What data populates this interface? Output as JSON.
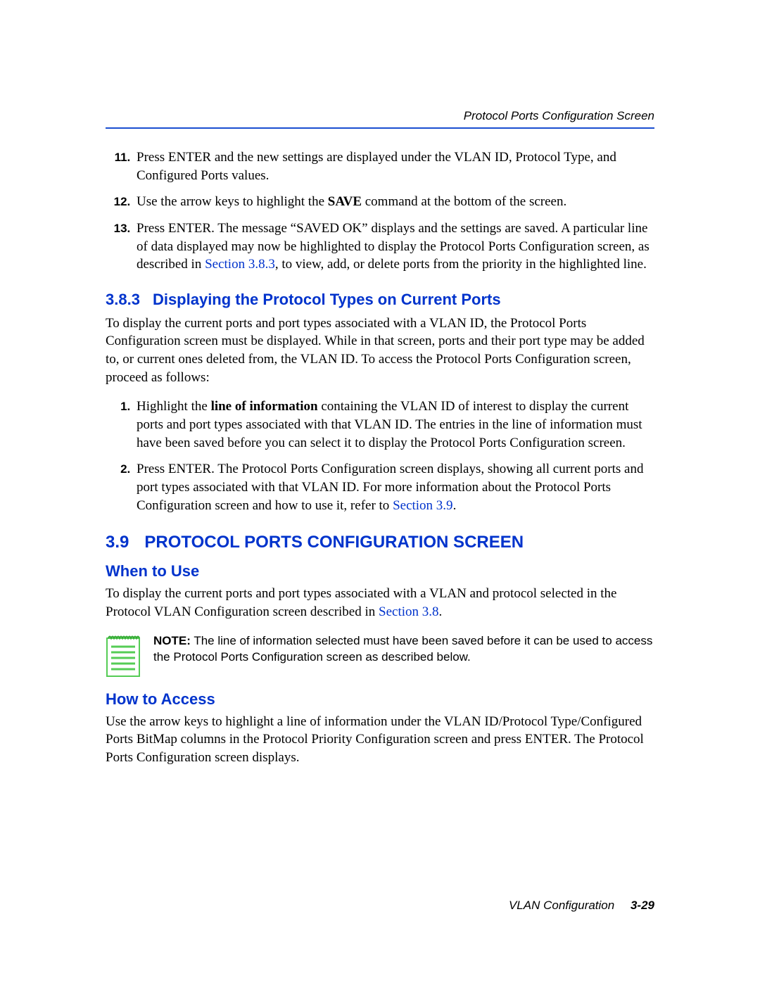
{
  "header": {
    "running_title": "Protocol Ports Configuration Screen"
  },
  "steps_a": {
    "start": 11,
    "items": [
      {
        "prefix": "Press ENTER and the new settings are displayed under the VLAN ID, Protocol Type, and Configured Ports values."
      },
      {
        "prefix": "Use the arrow keys to highlight the ",
        "bold": "SAVE",
        "suffix": " command at the bottom of the screen."
      },
      {
        "prefix": "Press ENTER. The message “SAVED OK” displays and the settings are saved. A particular line of data displayed may now be highlighted to display the Protocol Ports Configuration screen, as described in ",
        "link": "Section 3.8.3",
        "suffix": ", to view, add, or delete ports from the priority in the highlighted line."
      }
    ]
  },
  "section_383": {
    "number": "3.8.3",
    "title": "Displaying the Protocol Types on Current Ports",
    "intro": "To display the current ports and port types associated with a VLAN ID, the Protocol Ports Configuration screen must be displayed. While in that screen, ports and their port type may be added to, or current ones deleted from, the VLAN ID. To access the Protocol Ports Configuration screen, proceed as follows:"
  },
  "steps_b": {
    "start": 1,
    "items": [
      {
        "prefix": "Highlight the ",
        "bold": "line of information",
        "suffix": " containing the VLAN ID of interest to display the current ports and port types associated with that VLAN ID. The entries in the line of information must have been saved before you can select it to display the Protocol Ports Configuration screen."
      },
      {
        "prefix": "Press ENTER. The Protocol Ports Configuration screen displays, showing all current ports and port types associated with that VLAN ID. For more information about the Protocol Ports Configuration screen and how to use it, refer to ",
        "link": "Section 3.9",
        "suffix": "."
      }
    ]
  },
  "section_39": {
    "number": "3.9",
    "title": "PROTOCOL PORTS CONFIGURATION SCREEN",
    "when_title": "When to Use",
    "when_text_prefix": "To display the current ports and port types associated with a VLAN and protocol selected in the Protocol VLAN Configuration screen described in ",
    "when_text_link": "Section 3.8",
    "when_text_suffix": ".",
    "note_label": "NOTE:",
    "note_text": "The line of information selected must have been saved before it can be used to access the Protocol Ports Configuration screen as described below.",
    "how_title": "How to Access",
    "how_text": "Use the arrow keys to highlight a line of information under the VLAN ID/Protocol Type/Configured Ports BitMap columns in the Protocol Priority Configuration screen and press ENTER. The Protocol Ports Configuration screen displays."
  },
  "footer": {
    "title": "VLAN Configuration",
    "page": "3-29"
  }
}
